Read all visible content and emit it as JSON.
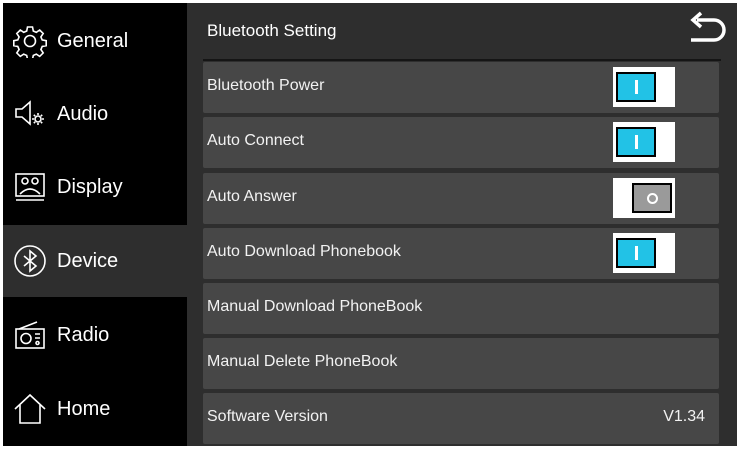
{
  "sidebar": {
    "items": [
      {
        "label": "General",
        "icon": "gear-icon",
        "active": false
      },
      {
        "label": "Audio",
        "icon": "speaker-settings-icon",
        "active": false
      },
      {
        "label": "Display",
        "icon": "display-icon",
        "active": false
      },
      {
        "label": "Device",
        "icon": "bluetooth-icon",
        "active": true
      },
      {
        "label": "Radio",
        "icon": "radio-icon",
        "active": false
      },
      {
        "label": "Home",
        "icon": "home-icon",
        "active": false
      }
    ]
  },
  "header": {
    "title": "Bluetooth Setting",
    "back_icon": "back-arrow-icon"
  },
  "settings": [
    {
      "label": "Bluetooth Power",
      "type": "toggle",
      "state": "on"
    },
    {
      "label": "Auto Connect",
      "type": "toggle",
      "state": "on"
    },
    {
      "label": "Auto Answer",
      "type": "toggle",
      "state": "off"
    },
    {
      "label": "Auto Download Phonebook",
      "type": "toggle",
      "state": "on"
    },
    {
      "label": "Manual Download PhoneBook",
      "type": "action"
    },
    {
      "label": "Manual Delete PhoneBook",
      "type": "action"
    },
    {
      "label": "Software Version",
      "type": "info",
      "value": "V1.34"
    }
  ],
  "colors": {
    "toggle_on": "#22c2e6",
    "toggle_off": "#9a9a9a",
    "row_bg": "#474747",
    "panel_bg": "#2e2e2e",
    "sidebar_bg": "#000000"
  }
}
